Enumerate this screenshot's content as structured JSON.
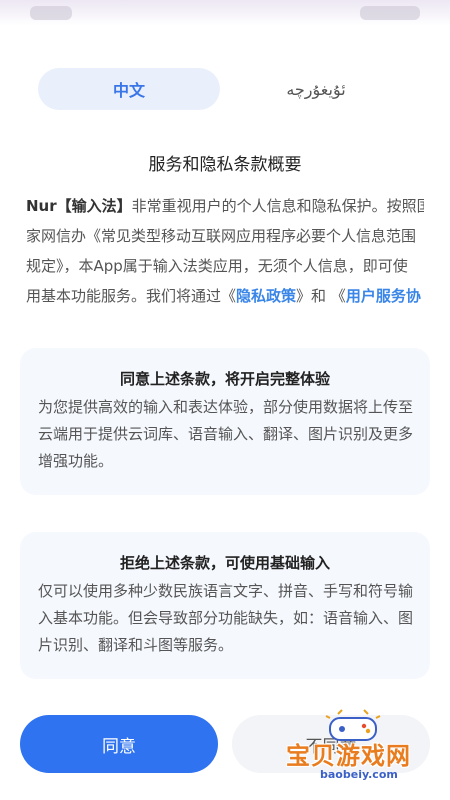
{
  "language_toggle": {
    "active_label": "中文",
    "inactive_label": "ئۇيغۇرچە"
  },
  "title": "服务和隐私条款概要",
  "intro": {
    "line1_bold": "Nur【输入法】",
    "line1_rest": "非常重视用户的个人信息和隐私保护。按照国",
    "line2": "家网信办《常见类型移动互联网应用程序必要个人信息范围",
    "line3": "规定》，本App属于输入法类应用，无须个人信息，即可使",
    "line4_prefix": "用基本功能服务。我们将通过《",
    "privacy_link": "隐私政策",
    "line4_mid": "》和 《",
    "terms_link": "用户服务协"
  },
  "agree_card": {
    "title": "同意上述条款，将开启完整体验",
    "body_lines": [
      "为您提供高效的输入和表达体验，部分使用数据将上传至",
      "云端用于提供云词库、语音输入、翻译、图片识别及更多",
      "增强功能。"
    ]
  },
  "reject_card": {
    "title": "拒绝上述条款，可使用基础输入",
    "body_lines": [
      "仅可以使用多种少数民族语言文字、拼音、手写和符号输",
      "入基本功能。但会导致部分功能缺失，如：语音输入、图",
      "片识别、翻译和斗图等服务。"
    ]
  },
  "buttons": {
    "agree_label": "同意",
    "reject_label": "不同意"
  },
  "watermark": {
    "text": "宝贝游戏网",
    "domain": "baobeiy.com"
  },
  "colors": {
    "accent": "#2f73f0",
    "link": "#3a86e8",
    "card_bg": "#f5f8fd",
    "active_tab_bg": "#e9f0fc"
  },
  "icons": {
    "watermark_logo": "gamepad-icon"
  }
}
